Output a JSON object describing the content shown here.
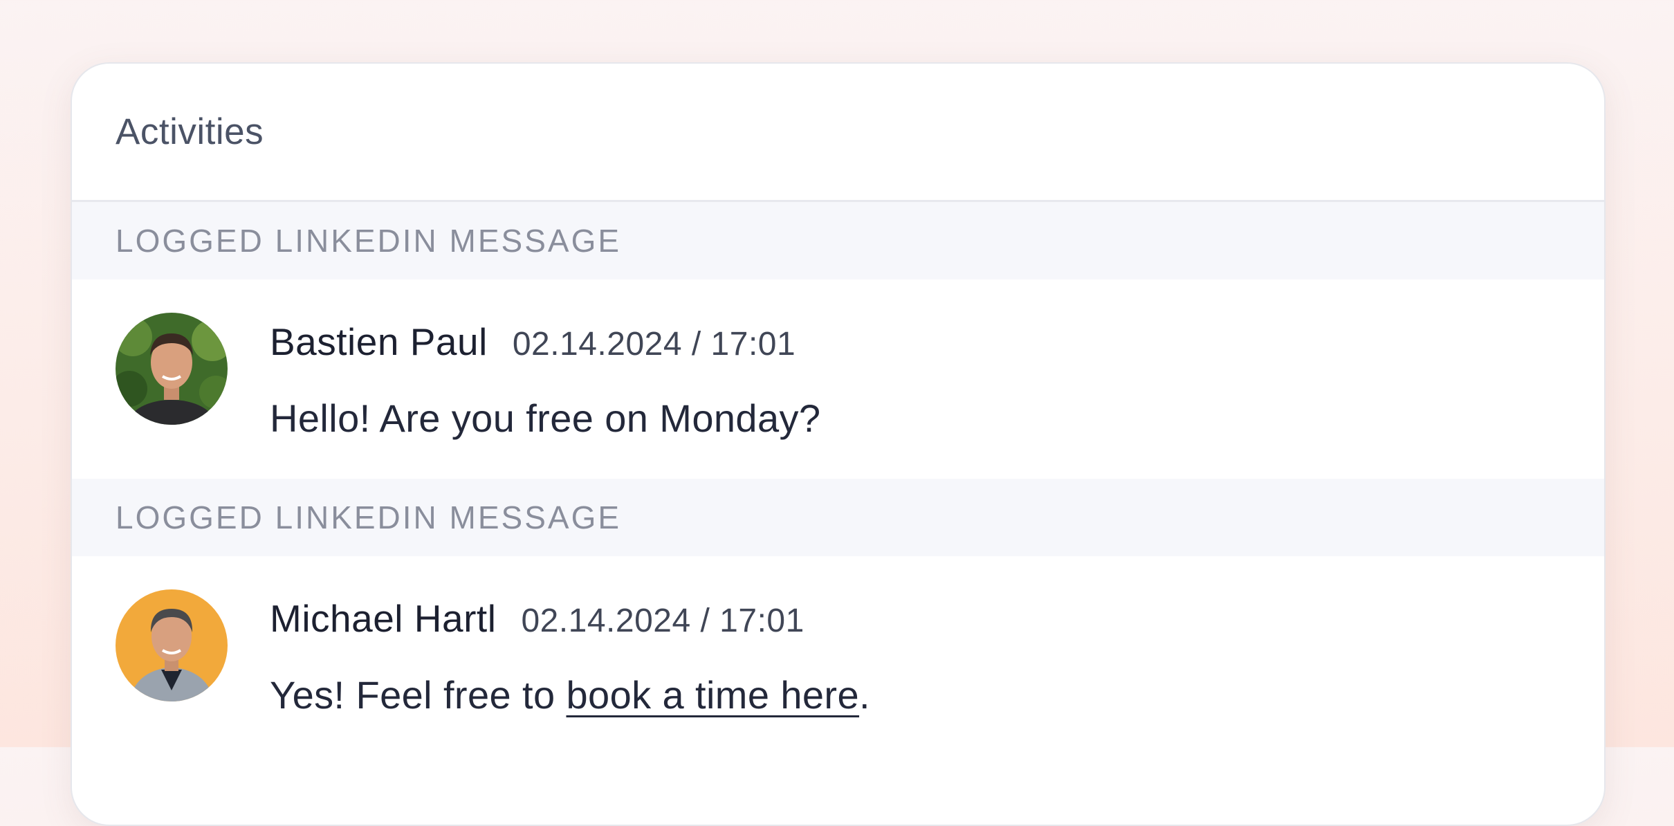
{
  "card": {
    "title": "Activities"
  },
  "activities": [
    {
      "type_label": "LOGGED LINKEDIN MESSAGE",
      "author": "Bastien Paul",
      "timestamp": "02.14.2024 / 17:01",
      "message": "Hello! Are you free on Monday?"
    },
    {
      "type_label": "LOGGED LINKEDIN MESSAGE",
      "author": "Michael Hartl",
      "timestamp": "02.14.2024 / 17:01",
      "message_prefix": "Yes! Feel free to ",
      "message_link": "book a time here",
      "message_suffix": "."
    }
  ],
  "colors": {
    "background": "#fdeee9",
    "section_bg": "#f6f7fb",
    "avatar_1_bg": "#3f6b2a",
    "avatar_2_bg": "#f2a93b"
  }
}
